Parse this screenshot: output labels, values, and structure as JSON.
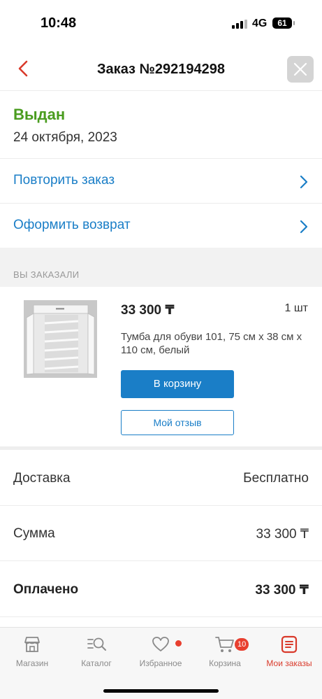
{
  "statusbar": {
    "time": "10:48",
    "network": "4G",
    "battery": "61"
  },
  "header": {
    "title": "Заказ №292194298"
  },
  "order": {
    "status": "Выдан",
    "status_color": "#4a9c1f",
    "date": "24 октября, 2023"
  },
  "actions": [
    {
      "label": "Повторить заказ"
    },
    {
      "label": "Оформить возврат"
    }
  ],
  "section": {
    "ordered_label": "ВЫ ЗАКАЗАЛИ"
  },
  "product": {
    "price": "33 300 ₸",
    "quantity": "1 шт",
    "name": "Тумба для обуви 101, 75 см x 38 см x 110 см, белый",
    "add_to_cart_label": "В корзину",
    "review_label": "Мой отзыв"
  },
  "summary": [
    {
      "key": "Доставка",
      "value": "Бесплатно"
    },
    {
      "key": "Сумма",
      "value": "33 300 ₸"
    },
    {
      "key": "Оплачено",
      "value": "33 300 ₸"
    }
  ],
  "tabbar": {
    "items": [
      {
        "label": "Магазин",
        "icon": "store-icon"
      },
      {
        "label": "Каталог",
        "icon": "catalog-search-icon"
      },
      {
        "label": "Избранное",
        "icon": "heart-icon"
      },
      {
        "label": "Корзина",
        "icon": "cart-icon",
        "badge": "10"
      },
      {
        "label": "Мои заказы",
        "icon": "orders-icon"
      }
    ],
    "active_index": 4
  },
  "colors": {
    "accent": "#1a7ec7",
    "brand": "#d93a2b",
    "success": "#4a9c1f"
  }
}
